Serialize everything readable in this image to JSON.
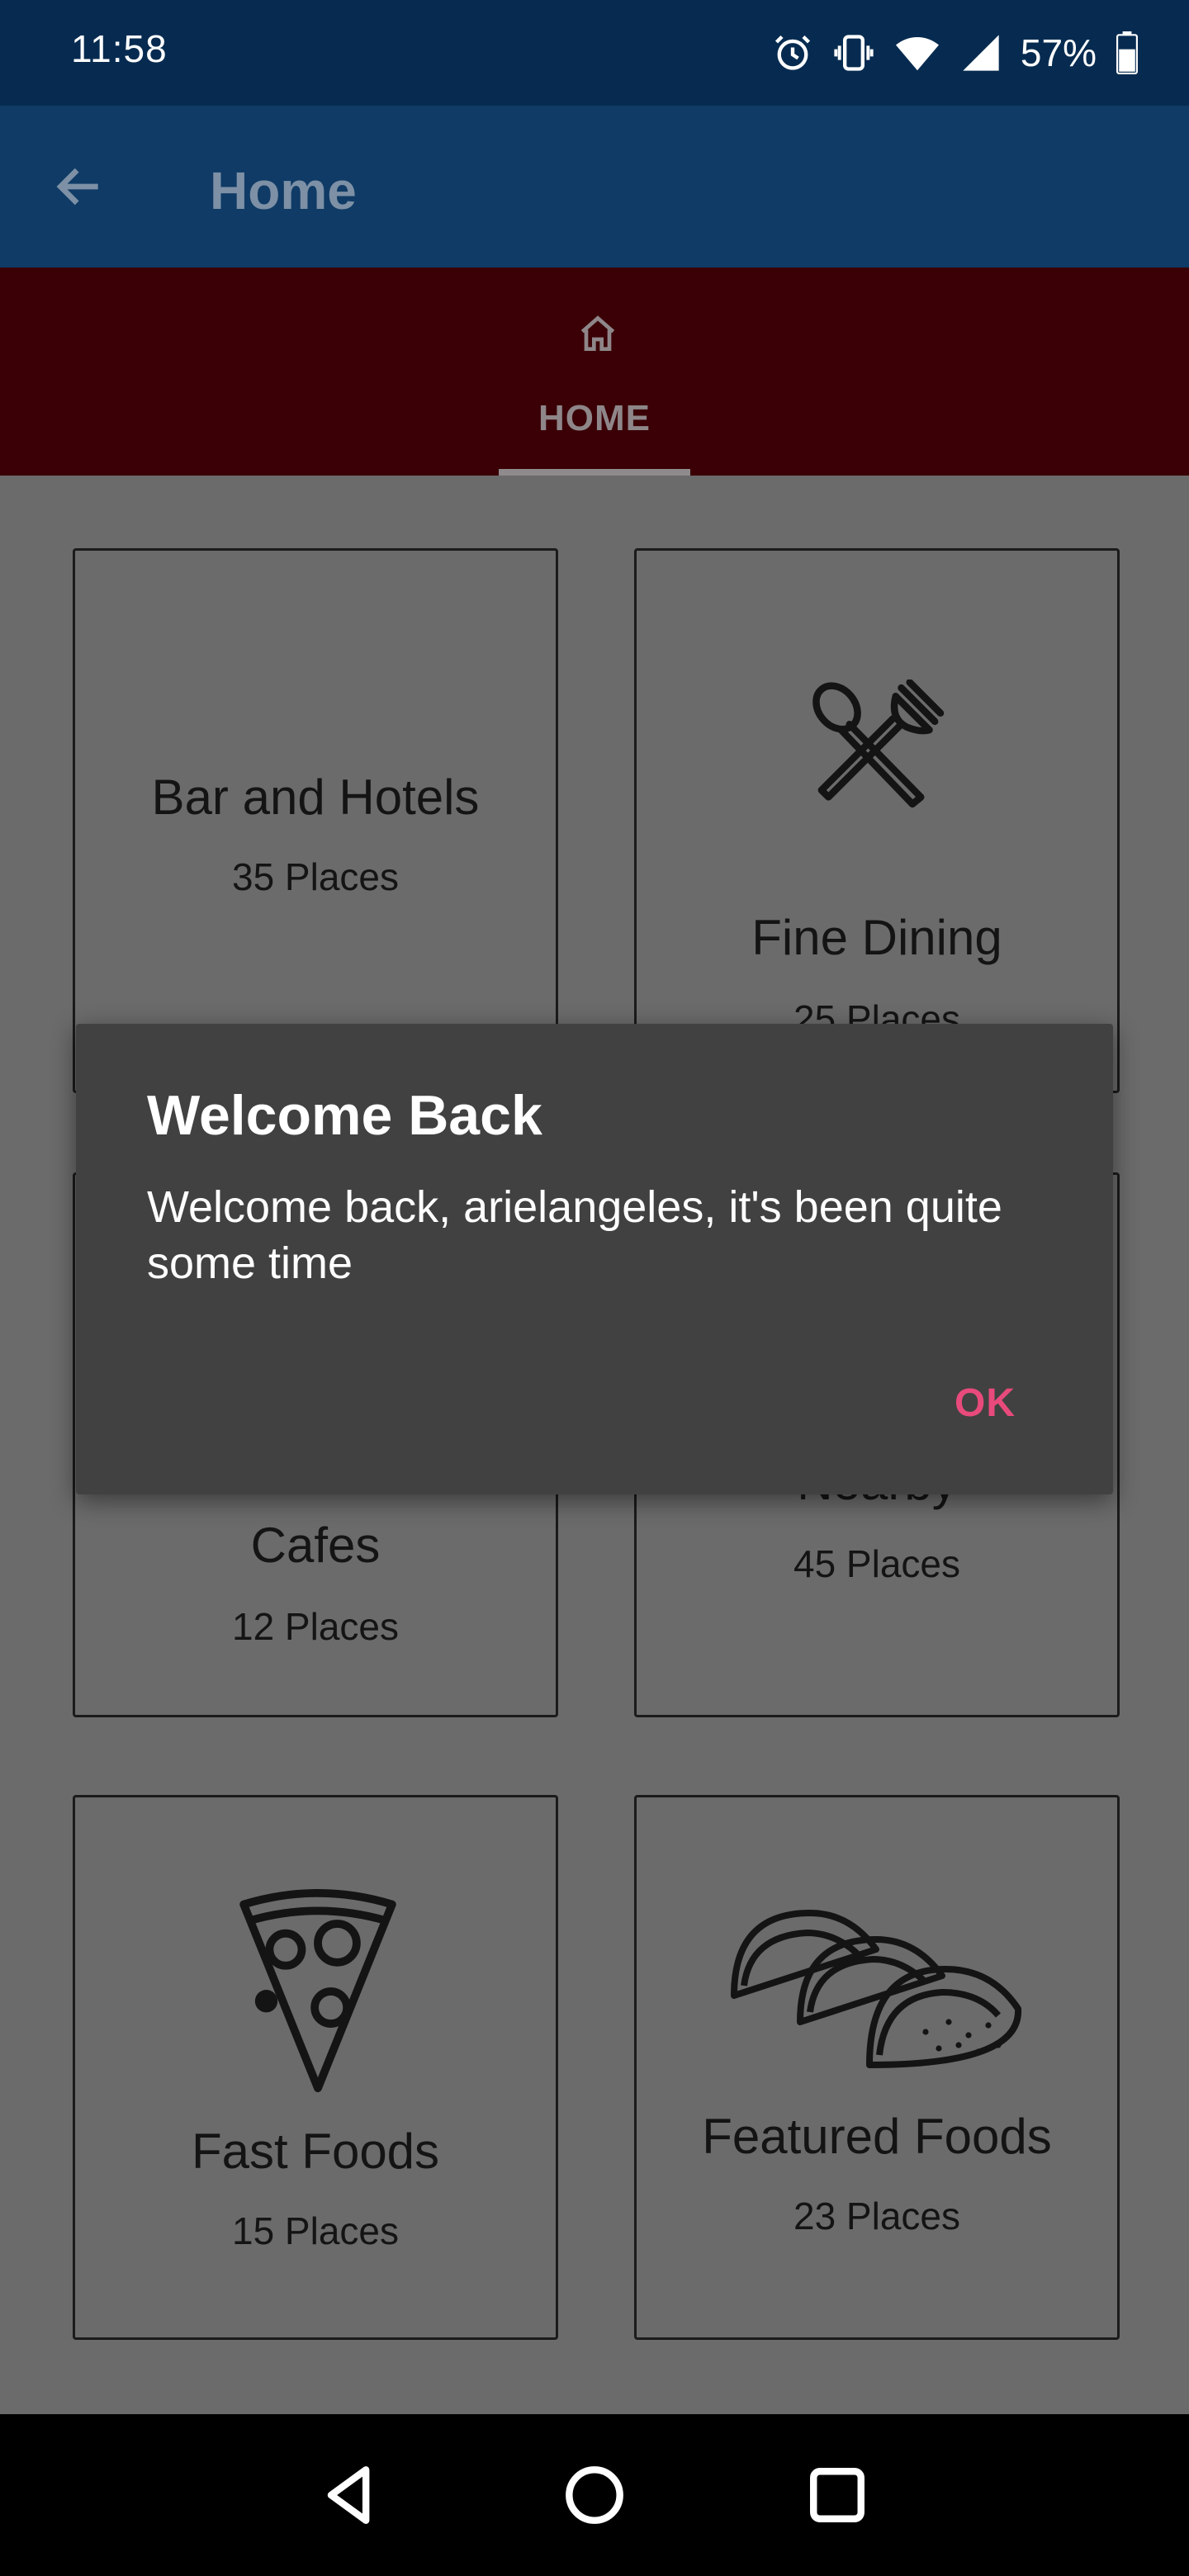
{
  "status_bar": {
    "time": "11:58",
    "battery": "57%"
  },
  "app_bar": {
    "title": "Home"
  },
  "tabs": [
    {
      "label": "HOME"
    }
  ],
  "cards": [
    {
      "title": "Bar and Hotels",
      "subtitle": "35 Places"
    },
    {
      "title": "Fine Dining",
      "subtitle": "25 Places"
    },
    {
      "title": "Cafes",
      "subtitle": "12 Places"
    },
    {
      "title": "Nearby",
      "subtitle": "45 Places"
    },
    {
      "title": "Fast Foods",
      "subtitle": "15 Places"
    },
    {
      "title": "Featured Foods",
      "subtitle": "23 Places"
    }
  ],
  "dialog": {
    "title": "Welcome Back",
    "message": "Welcome back, arielangeles, it's been quite some time",
    "ok_label": "OK"
  },
  "colors": {
    "status_bar": "#072b50",
    "app_bar": "#0f3b66",
    "tab_bar": "#3a0006",
    "dialog_bg": "#414141",
    "accent": "#e84a7c"
  },
  "icons": [
    "back-arrow-icon",
    "home-icon",
    "alarm-icon",
    "vibrate-icon",
    "wifi-icon",
    "signal-icon",
    "battery-icon",
    "fork-spoon-icon",
    "pizza-icon",
    "taco-icon",
    "nav-back-icon",
    "nav-home-icon",
    "nav-recents-icon"
  ]
}
